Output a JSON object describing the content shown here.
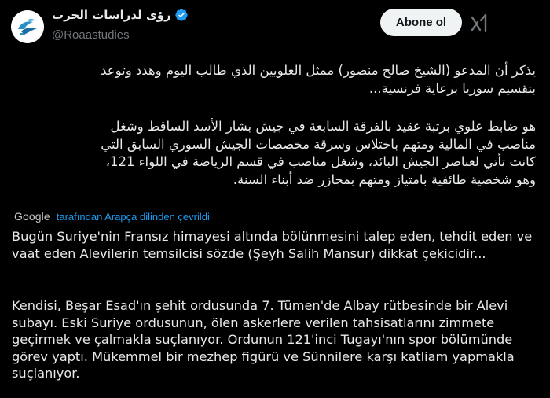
{
  "account": {
    "display_name": "رؤى لدراسات الحرب",
    "handle": "@Roaastudies",
    "verified": true,
    "avatar_icon": "roaa-logo-icon",
    "accent_color": "#1d9bf0"
  },
  "actions": {
    "follow_label": "Abone ol",
    "grok_icon": "grok-xai-icon"
  },
  "tweet": {
    "original_paragraph_1": "يذكر أن المدعو (الشيخ صالح منصور) ممثل العلويين الذي طالب اليوم وهدد وتوعد\nبتقسيم سوريا برعاية فرنسية...",
    "original_paragraph_2": "هو ضابط علوي برتبة عقيد بالفرقة السابعة في جيش بشار الأسد الساقط وشغل\nمناصب في المالية ومتهم باختلاس وسرقة مخصصات الجيش السوري السابق التي\nكانت تأتي لعناصر الجيش البائد، وشغل مناصب في قسم الرياضة في اللواء 121،\nوهو شخصية طائفية بامتياز ومتهم بمجازر ضد أبناء السنة.",
    "translation_provider": "Google",
    "translation_note": "tarafından Arapça dilinden çevrildi",
    "translated_paragraph_1": "Bugün Suriye'nin Fransız himayesi altında bölünmesini talep eden, tehdit eden ve vaat eden Alevilerin temsilcisi sözde (Şeyh Salih Mansur) dikkat çekicidir...",
    "translated_paragraph_2": "Kendisi, Beşar Esad'ın şehit ordusunda 7. Tümen'de Albay rütbesinde bir Alevi subayı. Eski Suriye ordusunun, ölen askerlere verilen tahsisatlarını zimmete geçirmek ve çalmakla suçlanıyor. Ordunun 121'inci Tugayı'nın spor bölümünde görev yaptı. Mükemmel bir mezhep figürü ve Sünnilere karşı katliam yapmakla suçlanıyor."
  }
}
